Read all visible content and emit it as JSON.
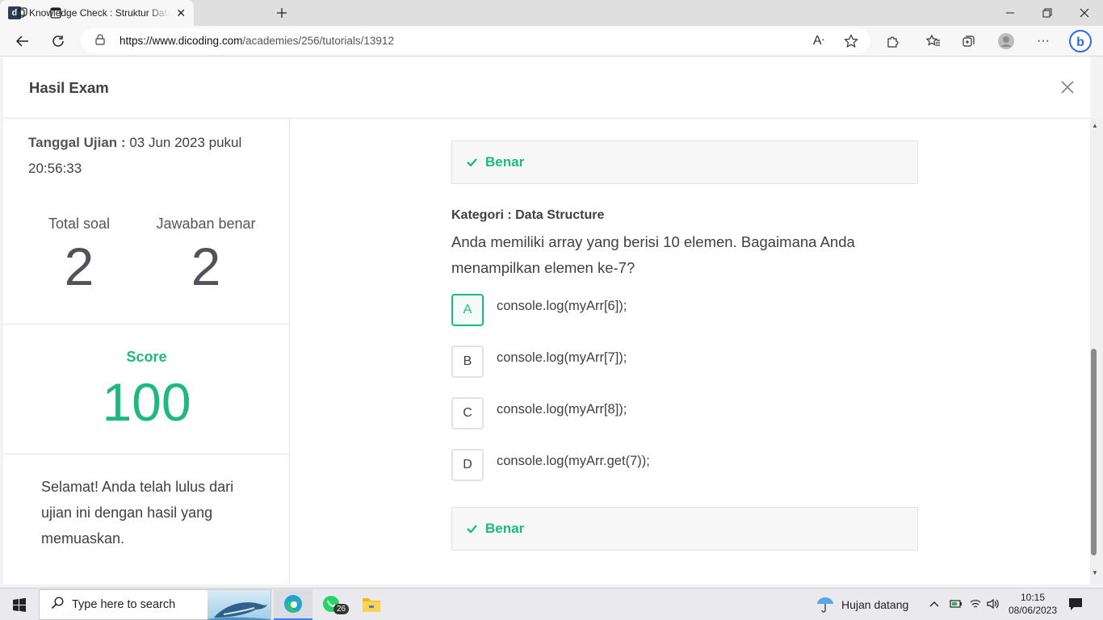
{
  "browser": {
    "tab_title": "Knowledge Check : Struktur Data",
    "tab_favicon": "d",
    "url_host": "https://www.dicoding.com",
    "url_path": "/academies/256/tutorials/13912"
  },
  "modal": {
    "title": "Hasil Exam"
  },
  "summary": {
    "date_label": "Tanggal Ujian :",
    "date_value": "03 Jun 2023 pukul 20:56:33",
    "total_label": "Total soal",
    "total_value": "2",
    "correct_label": "Jawaban benar",
    "correct_value": "2",
    "score_label": "Score",
    "score_value": "100",
    "message": "Selamat! Anda telah lulus dari ujian ini dengan hasil yang memuaskan."
  },
  "question": {
    "prev_result": "Benar",
    "category": "Kategori : Data Structure",
    "text": "Anda memiliki array yang berisi 10 elemen. Bagaimana Anda menampilkan elemen ke-7?",
    "options": [
      {
        "key": "A",
        "text": "console.log(myArr[6]);",
        "selected": true
      },
      {
        "key": "B",
        "text": "console.log(myArr[7]);",
        "selected": false
      },
      {
        "key": "C",
        "text": "console.log(myArr[8]);",
        "selected": false
      },
      {
        "key": "D",
        "text": "console.log(myArr.get(7));",
        "selected": false
      }
    ],
    "result": "Benar"
  },
  "taskbar": {
    "search_placeholder": "Type here to search",
    "whatsapp_badge": "26",
    "weather": "Hujan datang",
    "time": "10:15",
    "date": "08/06/2023"
  },
  "colors": {
    "accent": "#1eb980",
    "text": "#3f3f46"
  }
}
